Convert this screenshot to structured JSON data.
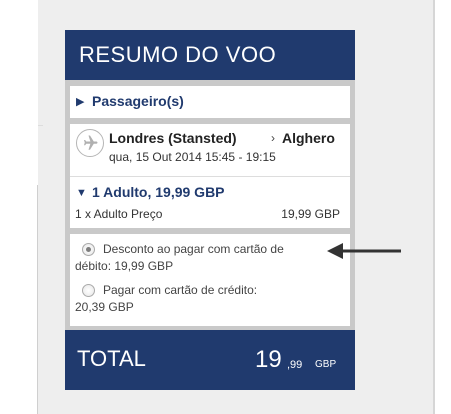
{
  "summary": {
    "title": "RESUMO DO VOO",
    "passengers_label": "Passageiro(s)",
    "flight": {
      "from": "Londres (Stansted)",
      "arrow": "›",
      "to": "Alghero",
      "datetime": "qua, 15 Out 2014 15:45 - 19:15"
    },
    "fare": {
      "title": "1 Adulto, 19,99 GBP",
      "line_label": "1 x Adulto Preço",
      "line_price": "19,99 GBP"
    },
    "payment": {
      "option1_line1": "Desconto ao pagar com cartão de",
      "option1_line2": "débito: 19,99 GBP",
      "option2_line1": "Pagar com cartão de crédito:",
      "option2_line2": "20,39 GBP"
    },
    "total": {
      "label": "TOTAL",
      "int": "19",
      "dec": ",99",
      "currency": "GBP"
    }
  },
  "colors": {
    "brand_navy": "#203a6e",
    "panel_grey": "#c9c9c9"
  },
  "icons": {
    "flight": "plane-icon",
    "expand": "triangle-right-icon",
    "collapse": "triangle-down-icon",
    "annotation": "arrow-left-icon"
  }
}
